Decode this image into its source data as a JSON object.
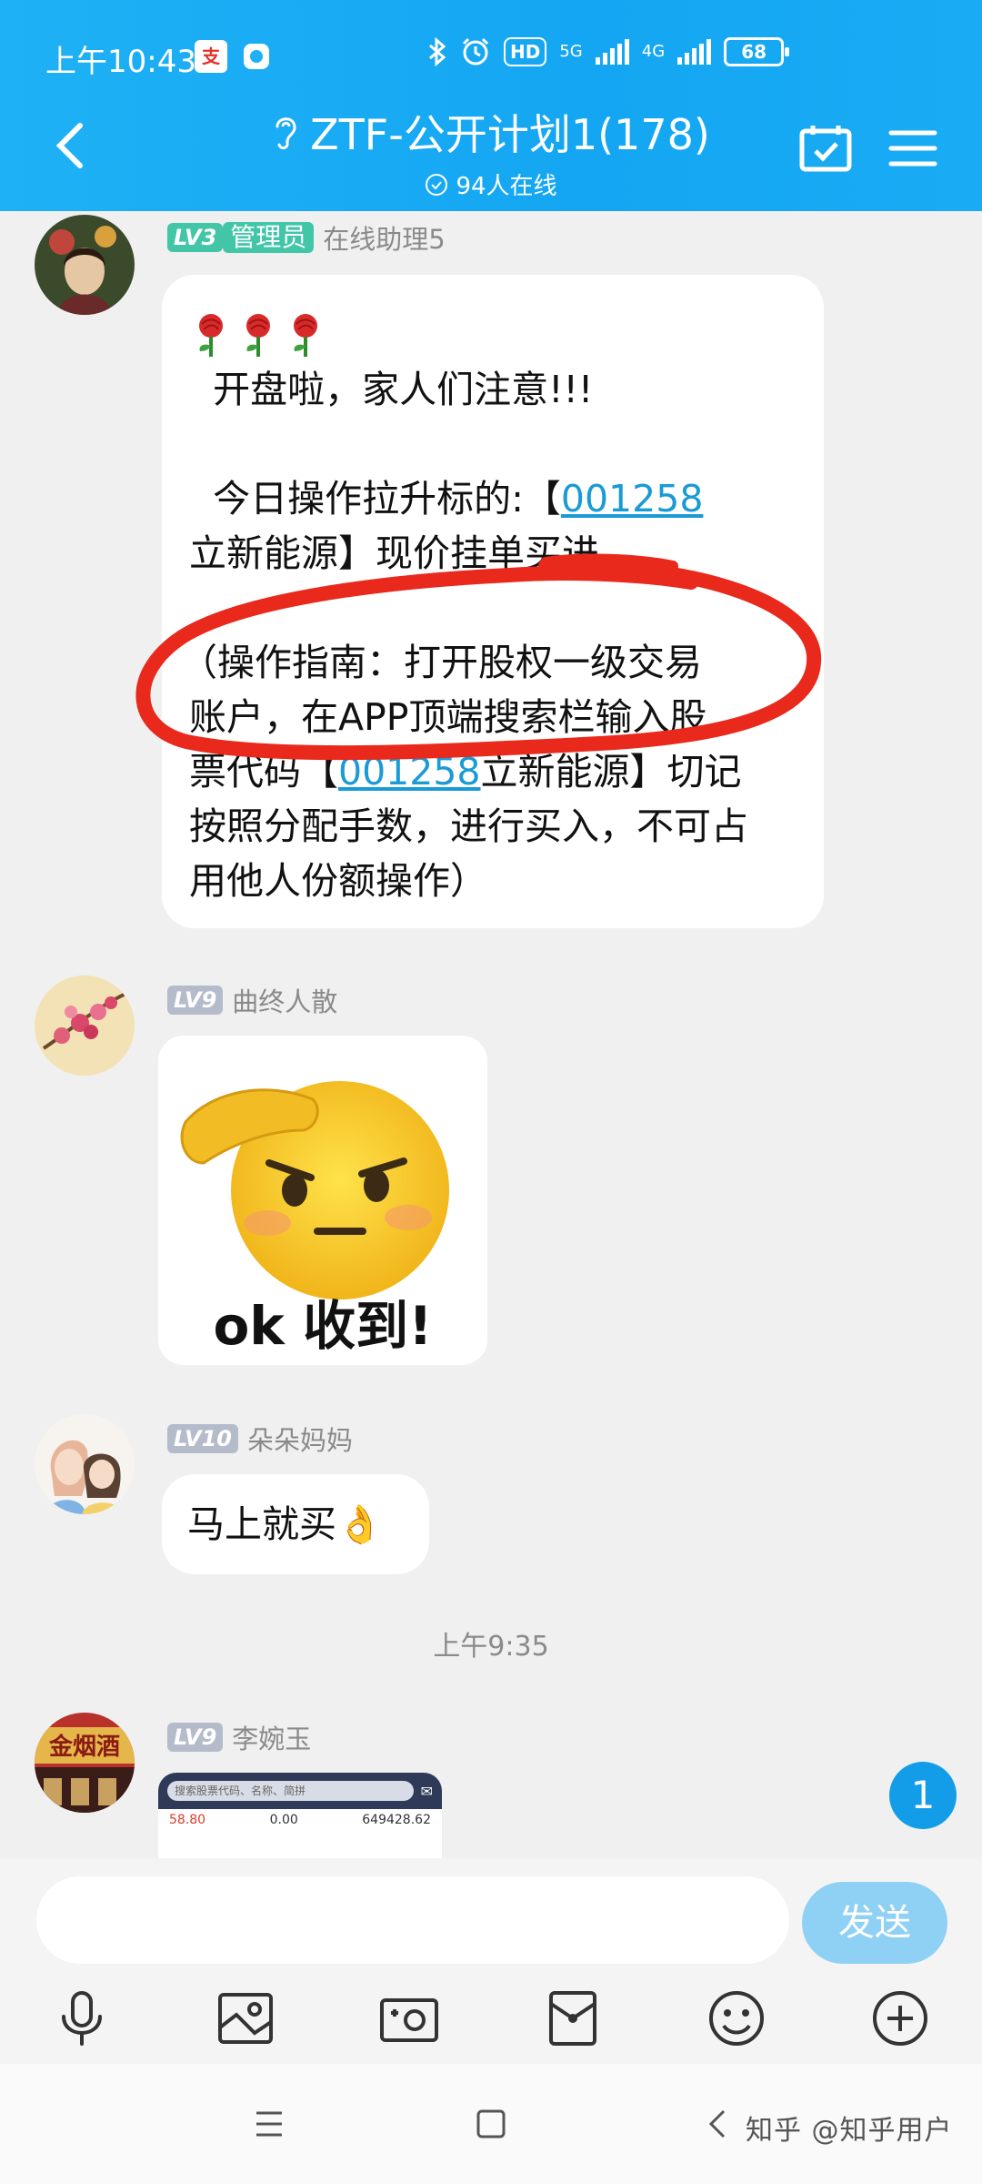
{
  "status_bar": {
    "time": "上午10:43",
    "badge": "支",
    "network_5g": "5G",
    "network_4g": "4G",
    "hd": "HD",
    "battery": "68"
  },
  "header": {
    "title": "ZTF-公开计划1(178)",
    "online": "94人在线"
  },
  "messages": [
    {
      "sender": "在线助理5",
      "level": "LV3",
      "role": "管理员",
      "lines": [
        "  开盘啦，家人们注意!!!",
        "",
        "  今日操作拉升标的:【",
        "立新能源】现价挂单买进",
        "",
        "（操作指南：打开股权一级交易",
        "账户，在APP顶端搜索栏输入股",
        "票代码【",
        "按照分配手数，进行买入，不可占",
        "用他人份额操作）"
      ],
      "stock_code": "001258",
      "line8_suffix": "立新能源】切记"
    },
    {
      "sender": "曲终人散",
      "level": "LV9",
      "sticker_text": "ok 收到!"
    },
    {
      "sender": "朵朵妈妈",
      "level": "LV10",
      "text": "马上就买👌"
    },
    {
      "sender": "李婉玉",
      "level": "LV9",
      "thumb": {
        "search": "搜索股票代码、名称、简拼",
        "values": [
          "58.80",
          "0.00",
          "649428.62"
        ]
      }
    }
  ],
  "time_separator": "上午9:35",
  "unread_count": "1",
  "input": {
    "placeholder": "",
    "send_label": "发送"
  },
  "watermark": "知乎 @知乎用户",
  "avatar_texts": {
    "li": "金烟酒"
  },
  "colors": {
    "header": "#1fb1f5",
    "link": "#1a9ad6",
    "admin_badge": "#42c6a7",
    "annotation_circle": "#e8291c"
  }
}
